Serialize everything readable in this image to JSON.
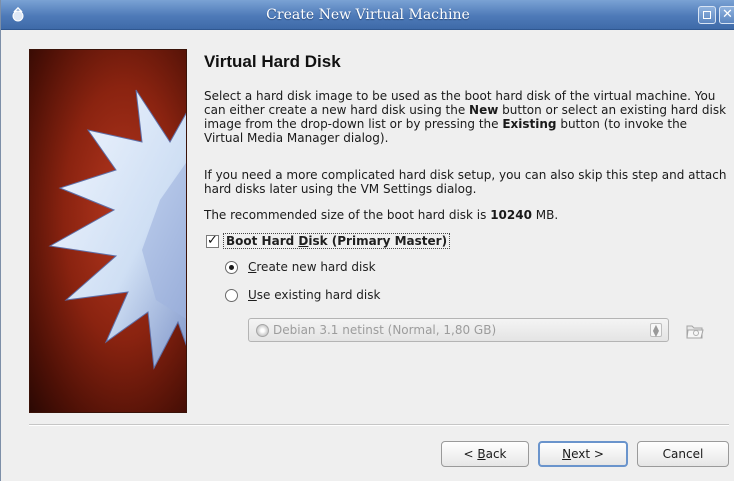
{
  "window": {
    "title": "Create New Virtual Machine",
    "icons": [
      "app-icon",
      "maximize-icon",
      "close-icon"
    ]
  },
  "page": {
    "heading": "Virtual Hard Disk",
    "p1": {
      "t1": "Select a hard disk image to be used as the boot hard disk of the virtual machine. You can either create a new hard disk using the ",
      "b1": "New",
      "t2": " button or select an existing hard disk image from the drop-down list or by pressing the ",
      "b2": "Existing",
      "t3": " button (to invoke the Virtual Media Manager dialog)."
    },
    "p2": "If you need a more complicated hard disk setup, you can also skip this step and attach hard disks later using the VM Settings dialog.",
    "p3": {
      "t1": "The recommended size of the boot hard disk is ",
      "b1": "10240",
      "t2": " MB."
    }
  },
  "boot_disk": {
    "checked": true,
    "label_pre": "Boot Hard ",
    "label_accel": "D",
    "label_post": "isk (Primary Master)"
  },
  "options": {
    "create": {
      "accel": "C",
      "rest": "reate new hard disk",
      "selected": true
    },
    "existing": {
      "accel": "U",
      "rest": "se existing hard disk",
      "selected": false
    }
  },
  "disk_select": {
    "value": "Debian 3.1 netinst (Normal, 1,80 GB)",
    "enabled": false
  },
  "buttons": {
    "back_pre": "< ",
    "back_accel": "B",
    "back_post": "ack",
    "next_accel": "N",
    "next_post": "ext >",
    "cancel": "Cancel"
  },
  "colors": {
    "titlebar": "#4e7ab8",
    "art_background": "#8a2310",
    "starburst": "#d8e6f7"
  }
}
